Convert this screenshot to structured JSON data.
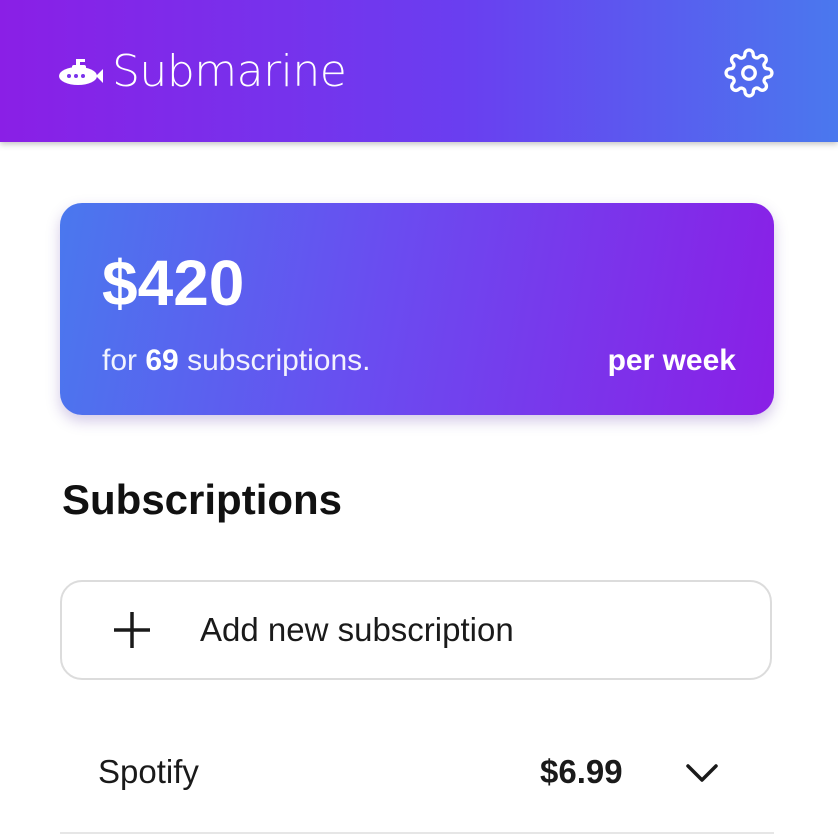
{
  "header": {
    "app_name": "Submarine",
    "brand_icon": "submarine-icon",
    "settings_icon": "gear-icon"
  },
  "summary": {
    "total": "$420",
    "prefix": "for",
    "count": "69",
    "suffix": "subscriptions.",
    "period": "per week"
  },
  "subscriptions": {
    "title": "Subscriptions",
    "add_label": "Add new subscription",
    "add_icon": "plus-icon",
    "items": [
      {
        "name": "Spotify",
        "price": "$6.99",
        "expand_icon": "chevron-down-icon"
      }
    ]
  },
  "colors": {
    "purple": "#8a1fe6",
    "blue": "#4a78ee",
    "white": "#ffffff"
  }
}
